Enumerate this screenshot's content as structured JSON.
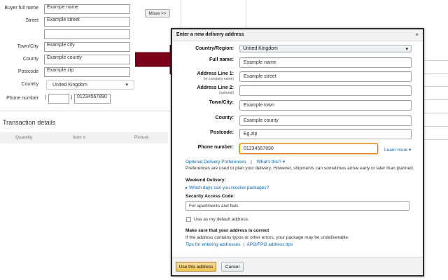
{
  "left_form": {
    "fields": [
      {
        "label": "Buyer full name",
        "value": "Exampe name"
      },
      {
        "label": "Street",
        "value": "Example street"
      },
      {
        "label": "",
        "value": ""
      },
      {
        "label": "Town/City",
        "value": "Example city"
      },
      {
        "label": "County",
        "value": "Example county"
      },
      {
        "label": "Postcode",
        "value": "Example zip"
      }
    ],
    "country_label": "Country",
    "country_value": "United Kingdom",
    "phone_label": "Phone number",
    "phone_open": "(",
    "phone_close": ")",
    "phone_value": "01234567890",
    "move_button": "Move >>"
  },
  "transaction": {
    "title": "Transaction details",
    "columns": [
      "Quantity",
      "Item #",
      "Picture"
    ]
  },
  "modal": {
    "title": "Enter a new delivery address",
    "close": "×",
    "country_label": "Country/Region:",
    "country_value": "United Kingdom",
    "full_name_label": "Full name:",
    "full_name_value": "Example name",
    "line1_label": "Address Line 1:",
    "line1_sub": "(or company name)",
    "line1_value": "Example street",
    "line2_label": "Address Line 2:",
    "line2_sub": "(optional)",
    "line2_value": "",
    "town_label": "Town/City:",
    "town_value": "Example town",
    "county_label": "County:",
    "county_value": "Example county",
    "postcode_label": "Postcode:",
    "postcode_value": "Eg.zip",
    "phone_label": "Phone number:",
    "phone_value": "01234567890",
    "learn_more": "Learn more ▾",
    "optional_prefs": "Optional Delivery Preferences",
    "separator": "|",
    "whats_this": "What's this? ▾",
    "prefs_note": "Preferences are used to plan your delivery. However, shipments can sometimes arrive early or later than planned.",
    "weekend_title": "Weekend Delivery:",
    "weekend_link": "▸ Which days can you receive packages?",
    "security_title": "Security Access Code:",
    "security_value": "For apartments and flats",
    "default_checkbox_label": "Use as my default address.",
    "correct_title": "Make sure that your address is correct",
    "correct_note": "If the address contains typos or other errors, your package may be undeliverable.",
    "tips_link": "Tips for entering addresses",
    "tips_sep": "|",
    "apo_link": "APO/FPO address tips",
    "use_button": "Use this address",
    "cancel_button": "Cancel"
  },
  "colors": {
    "arrow": "#7a0019",
    "focus": "#e77600",
    "link": "#0066c0",
    "primary_button": "#f0c14b"
  }
}
